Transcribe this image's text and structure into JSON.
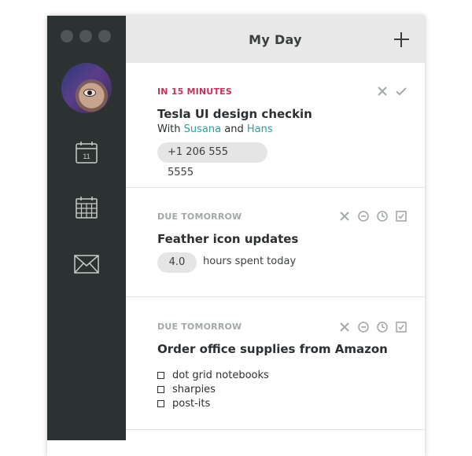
{
  "header": {
    "title": "My Day"
  },
  "colors": {
    "urgent": "#c8325a",
    "muted": "#a3a8a8",
    "accent": "#2aa198",
    "sidebar": "#2b3231"
  },
  "sidebar": {
    "icons": [
      "calendar-day-icon",
      "calendar-month-icon",
      "mail-icon"
    ],
    "calendar_day_number": "11"
  },
  "cards": [
    {
      "label": "IN 15 MINUTES",
      "title": "Tesla UI design checkin",
      "with_prefix": "With",
      "person1": "Susana",
      "conjunction": "and",
      "person2": "Hans",
      "phone": "+1 206 555 5555",
      "actions": [
        "close-icon",
        "check-icon"
      ]
    },
    {
      "label": "DUE TOMORROW",
      "title": "Feather icon updates",
      "hours_value": "4.0",
      "hours_text": "hours spent today",
      "actions": [
        "close-icon",
        "pause-icon",
        "clock-icon",
        "checkbox-icon"
      ]
    },
    {
      "label": "DUE TOMORROW",
      "title": "Order office supplies from Amazon",
      "checklist": [
        "dot grid notebooks",
        "sharpies",
        "post-its"
      ],
      "actions": [
        "close-icon",
        "pause-icon",
        "clock-icon",
        "checkbox-icon"
      ]
    }
  ]
}
